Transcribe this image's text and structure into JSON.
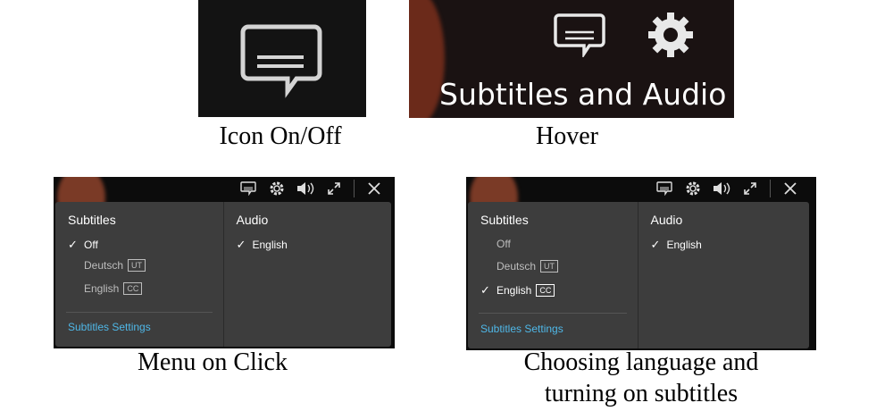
{
  "captions": {
    "icon": "Icon On/Off",
    "hover": "Hover",
    "menu": "Menu on Click",
    "choosing_line1": "Choosing language and",
    "choosing_line2": "turning on subtitles"
  },
  "hover_panel": {
    "tooltip": "Subtitles and Audio"
  },
  "menu_click": {
    "subtitles_title": "Subtitles",
    "audio_title": "Audio",
    "subtitle_options": [
      {
        "label": "Off",
        "badge": "",
        "selected": true
      },
      {
        "label": "Deutsch",
        "badge": "UT",
        "selected": false
      },
      {
        "label": "English",
        "badge": "CC",
        "selected": false
      }
    ],
    "audio_options": [
      {
        "label": "English",
        "selected": true
      }
    ],
    "settings_link": "Subtitles Settings"
  },
  "menu_choose": {
    "subtitles_title": "Subtitles",
    "audio_title": "Audio",
    "subtitle_options": [
      {
        "label": "Off",
        "badge": "",
        "selected": false
      },
      {
        "label": "Deutsch",
        "badge": "UT",
        "selected": false
      },
      {
        "label": "English",
        "badge": "CC",
        "selected": true
      }
    ],
    "audio_options": [
      {
        "label": "English",
        "selected": true
      }
    ],
    "settings_link": "Subtitles Settings"
  },
  "colors": {
    "menu_bg": "#3d3d3d",
    "link": "#4fb8e8",
    "player_bg": "#0c0c0c"
  },
  "icons": [
    "subtitles-icon",
    "gear-icon",
    "volume-icon",
    "fullscreen-icon",
    "close-icon",
    "check-icon"
  ]
}
